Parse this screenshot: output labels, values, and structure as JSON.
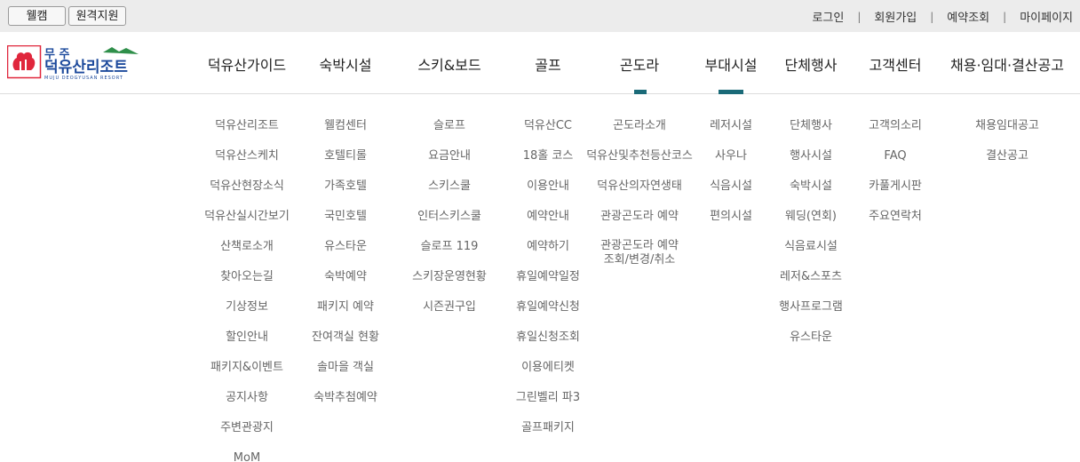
{
  "topbar": {
    "buttons": [
      "웰캠",
      "원격지원"
    ],
    "util_links": [
      "로그인",
      "회원가입",
      "예약조회",
      "마이페이지"
    ],
    "separator": "|"
  },
  "logo": {
    "line1": "무 주",
    "line2": "덕유산리조트",
    "line3": "MUJU DEOGYUSAN RESORT"
  },
  "gnb": [
    "덕유산가이드",
    "숙박시설",
    "스키&보드",
    "골프",
    "곤도라",
    "부대시설",
    "단체행사",
    "고객센터",
    "채용·임대·결산공고"
  ],
  "submenus": [
    [
      "덕유산리조트",
      "덕유산스케치",
      "덕유산현장소식",
      "덕유산실시간보기",
      "산책로소개",
      "찾아오는길",
      "기상정보",
      "할인안내",
      "패키지&이벤트",
      "공지사항",
      "주변관광지",
      "MoM"
    ],
    [
      "웰컴센터",
      "호텔티롤",
      "가족호텔",
      "국민호텔",
      "유스타운",
      "숙박예약",
      "패키지 예약",
      "잔여객실 현황",
      "솔마을 객실",
      "숙박추첨예약"
    ],
    [
      "슬로프",
      "요금안내",
      "스키스쿨",
      "인터스키스쿨",
      "슬로프 119",
      "스키장운영현황",
      "시즌권구입"
    ],
    [
      "덕유산CC",
      "18홀 코스",
      "이용안내",
      "예약안내",
      "예약하기",
      "휴일예약일정",
      "휴일예약신청",
      "휴일신청조회",
      "이용에티켓",
      "그린벨리 파3",
      "골프패키지"
    ],
    [
      "곤도라소개",
      "덕유산및추천등산코스",
      "덕유산의자연생태",
      "관광곤도라 예약",
      "관광곤도라 예약\n조회/변경/취소"
    ],
    [
      "레저시설",
      "사우나",
      "식음시설",
      "편의시설"
    ],
    [
      "단체행사",
      "행사시설",
      "숙박시설",
      "웨딩(연회)",
      "식음료시설",
      "레저&스포츠",
      "행사프로그램",
      "유스타운"
    ],
    [
      "고객의소리",
      "FAQ",
      "카풀게시판",
      "주요연락처"
    ],
    [
      "채용임대공고",
      "결산공고"
    ]
  ],
  "colors": {
    "accent": "#1a6a78",
    "logo_blue": "#1d4a9c",
    "logo_red": "#e0263c"
  }
}
